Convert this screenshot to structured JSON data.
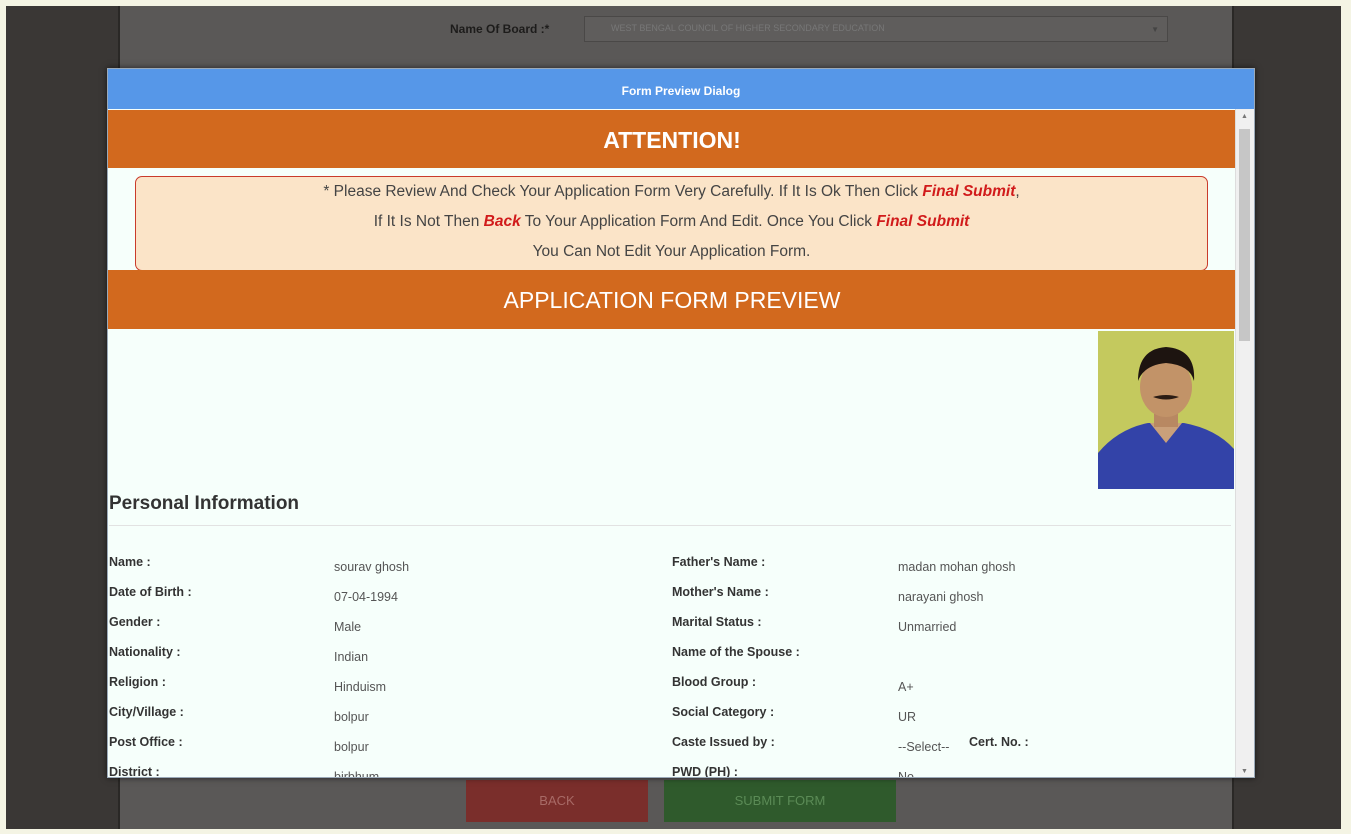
{
  "background": {
    "board_label": "Name Of Board :*",
    "board_value": "WEST BENGAL COUNCIL OF HIGHER SECONDARY EDUCATION",
    "back_button": "BACK",
    "submit_button": "SUBMIT FORM"
  },
  "dialog": {
    "title": "Form Preview Dialog",
    "attention": "ATTENTION!",
    "notice": {
      "line1_pre": "* Please Review And Check Your Application Form Very Carefully. If It Is Ok Then Click ",
      "line1_em": "Final Submit",
      "line1_post": ",",
      "line2_pre": "If It Is Not Then ",
      "line2_em1": "Back",
      "line2_mid": " To Your Application Form And Edit. Once You Click ",
      "line2_em2": "Final Submit",
      "line3": "You Can Not Edit Your Application Form."
    },
    "preview_heading": "APPLICATION FORM PREVIEW",
    "section_title": "Personal Information",
    "rows": [
      {
        "left_label": "Name :",
        "left_value": "sourav ghosh",
        "right_label": "Father's Name :",
        "right_value": "madan mohan ghosh"
      },
      {
        "left_label": "Date of Birth :",
        "left_value": "07-04-1994",
        "right_label": "Mother's Name :",
        "right_value": "narayani ghosh"
      },
      {
        "left_label": "Gender :",
        "left_value": "Male",
        "right_label": "Marital Status :",
        "right_value": "Unmarried"
      },
      {
        "left_label": "Nationality :",
        "left_value": "Indian",
        "right_label": "Name of the Spouse :",
        "right_value": ""
      },
      {
        "left_label": "Religion :",
        "left_value": "Hinduism",
        "right_label": "Blood Group :",
        "right_value": "A+"
      },
      {
        "left_label": "City/Village :",
        "left_value": "bolpur",
        "right_label": "Social Category :",
        "right_value": "UR"
      },
      {
        "left_label": "Post Office :",
        "left_value": "bolpur",
        "right_label": "Caste Issued by :",
        "right_value": "--Select--",
        "extra_label": "Cert. No. :"
      },
      {
        "left_label": "District :",
        "left_value": "birbhum",
        "right_label": "PWD (PH) :",
        "right_value": "No"
      }
    ]
  },
  "colors": {
    "title_bar": "#5697e8",
    "banner": "#d2691e",
    "notice_bg": "#fbe4c8",
    "emphasis": "#d11b1b"
  },
  "icons": {
    "scroll_up": "triangle-up",
    "scroll_down": "triangle-down",
    "dropdown": "caret-down"
  }
}
